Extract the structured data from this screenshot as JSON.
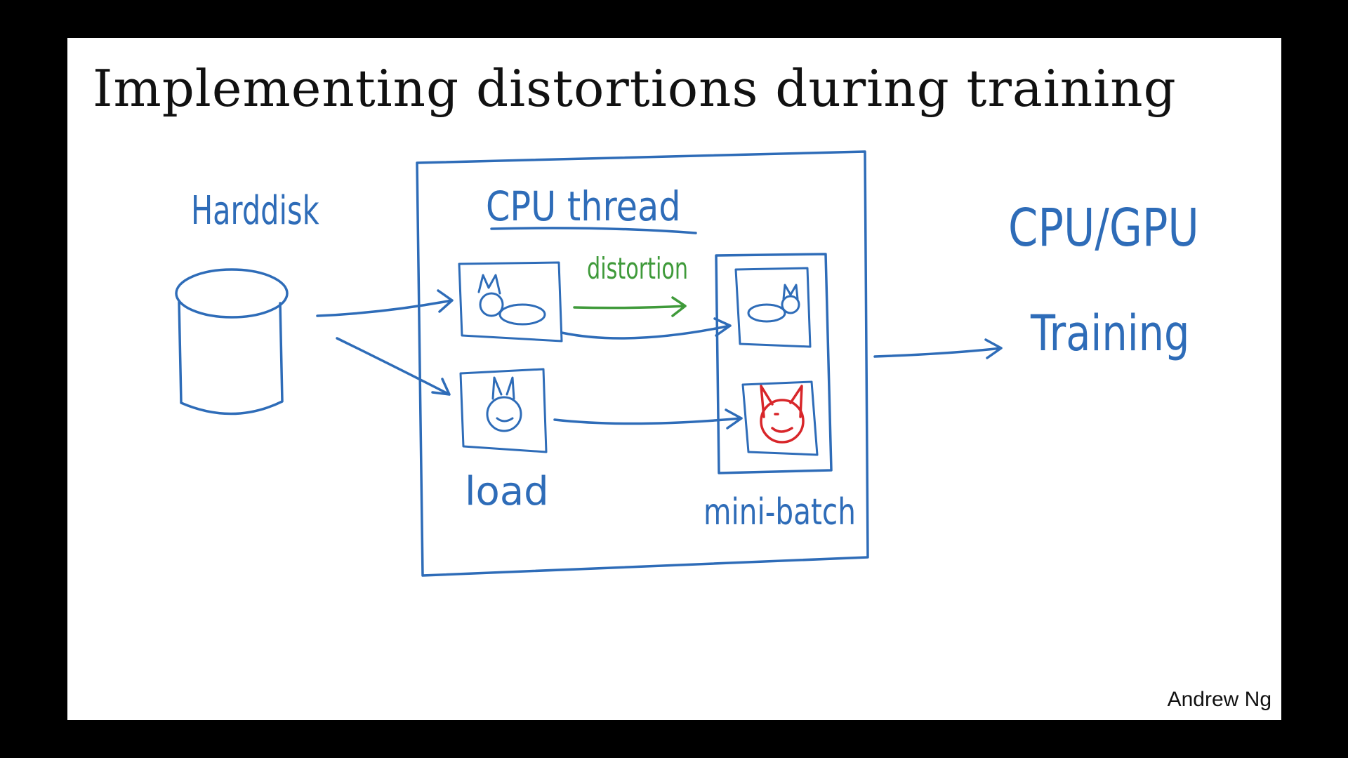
{
  "slide": {
    "title": "Implementing distortions during training",
    "author": "Andrew Ng"
  },
  "diagram": {
    "harddisk_label": "Harddisk",
    "cpu_thread_label": "CPU thread",
    "distortion_label": "distortion",
    "load_label": "load",
    "mini_batch_label": "mini-batch",
    "cpu_gpu_label": "CPU/GPU",
    "training_label": "Training"
  },
  "colors": {
    "ink_blue": "#2e6cb8",
    "ink_green": "#3f9a3a",
    "ink_red": "#d8262a",
    "title_text": "#111111",
    "background": "#ffffff"
  }
}
